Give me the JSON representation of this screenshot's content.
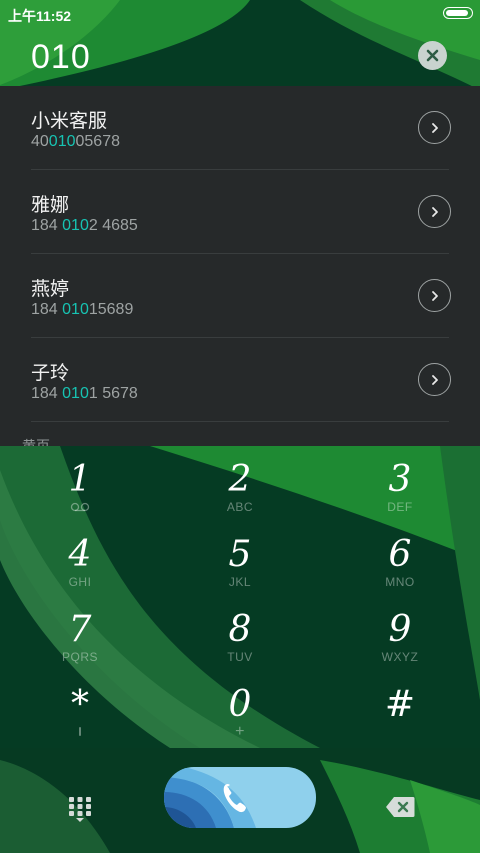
{
  "status_bar": {
    "time": "上午11:52",
    "battery_level": 0.95
  },
  "dial_input": {
    "value": "010"
  },
  "results": [
    {
      "name": "小米客服",
      "number_pre": "40",
      "number_match": "010",
      "number_post": "05678"
    },
    {
      "name": "雅娜",
      "number_pre": "184 ",
      "number_match": "010",
      "number_post": "2 4685"
    },
    {
      "name": "燕婷",
      "number_pre": "184 ",
      "number_match": "010",
      "number_post": "15689"
    },
    {
      "name": "子玲",
      "number_pre": "184 ",
      "number_match": "010",
      "number_post": "1 5678"
    }
  ],
  "section_label": "黄页",
  "keypad": [
    {
      "digit": "1",
      "letters": ""
    },
    {
      "digit": "2",
      "letters": "ABC"
    },
    {
      "digit": "3",
      "letters": "DEF"
    },
    {
      "digit": "4",
      "letters": "GHI"
    },
    {
      "digit": "5",
      "letters": "JKL"
    },
    {
      "digit": "6",
      "letters": "MNO"
    },
    {
      "digit": "7",
      "letters": "PQRS"
    },
    {
      "digit": "8",
      "letters": "TUV"
    },
    {
      "digit": "9",
      "letters": "WXYZ"
    },
    {
      "digit": "*",
      "letters": ""
    },
    {
      "digit": "0",
      "letters": "+"
    },
    {
      "digit": "#",
      "letters": ""
    }
  ],
  "icons": {
    "clear": "clear-icon",
    "row_action": "chevron-right-icon",
    "voicemail": "voicemail-icon",
    "keypad_toggle": "keypad-toggle-icon",
    "call": "phone-icon",
    "delete": "backspace-icon"
  },
  "colors": {
    "highlight": "#17c3b2",
    "background": "#053b23",
    "list_background": "#26292a"
  }
}
